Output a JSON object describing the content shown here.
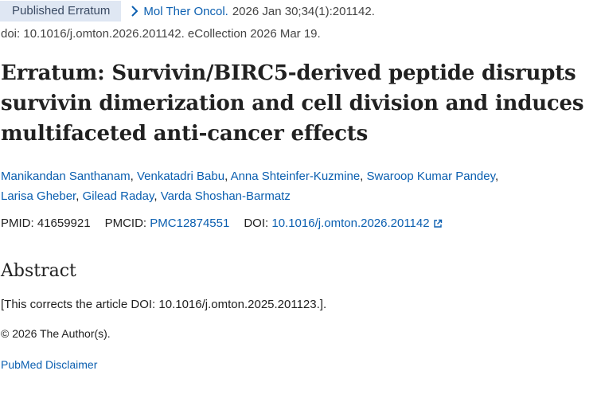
{
  "header": {
    "badge": "Published Erratum",
    "chevron_icon": "chevron-right-icon",
    "journal": "Mol Ther Oncol.",
    "citation": " 2026 Jan 30;34(1):201142.",
    "doi_line": "doi: 10.1016/j.omton.2026.201142. eCollection 2026 Mar 19."
  },
  "article": {
    "title": "Erratum: Survivin/BIRC5-derived peptide disrupts survivin dimerization and cell division and induces multifaceted anti-cancer effects",
    "authors": [
      "Manikandan Santhanam",
      "Venkatadri Babu",
      "Anna Shteinfer-Kuzmine",
      "Swaroop Kumar Pandey",
      "Larisa Gheber",
      "Gilead Raday",
      "Varda Shoshan-Barmatz"
    ],
    "pmid_label": "PMID:",
    "pmid": "41659921",
    "pmcid_label": "PMCID:",
    "pmcid": "PMC12874551",
    "doi_label": "DOI:",
    "doi": "10.1016/j.omton.2026.201142",
    "external_icon": "external-link-icon"
  },
  "abstract": {
    "heading": "Abstract",
    "text": "[This corrects the article DOI: 10.1016/j.omton.2025.201123.].",
    "copyright": "© 2026 The Author(s)."
  },
  "footer": {
    "disclaimer": "PubMed Disclaimer"
  },
  "colors": {
    "link": "#0b5fb0",
    "badge_bg": "#dfe7f3",
    "text": "#212121"
  }
}
